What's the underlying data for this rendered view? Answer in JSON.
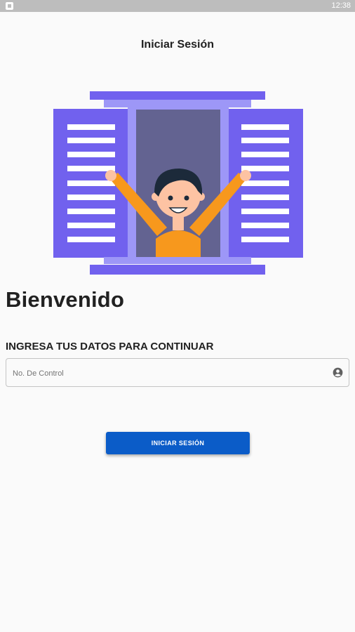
{
  "status_bar": {
    "time": "12:38",
    "app_icon": "app-notification-icon"
  },
  "header": {
    "title": "Iniciar Sesión"
  },
  "illustration": {
    "name": "window-boy-illustration",
    "colors": {
      "shutter": "#7161ee",
      "frame": "#9d97f7",
      "glass": "#636391",
      "slats": "#ffffff",
      "shirt": "#f7981d",
      "skin": "#fdc3a3",
      "hair": "#1c2a3a"
    }
  },
  "main": {
    "welcome": "Bienvenido",
    "subtitle": "INGRESA TUS DATOS PARA CONTINUAR",
    "control_field": {
      "placeholder": "No. De Control",
      "value": "",
      "icon": "account-circle-icon"
    },
    "login_button": {
      "label": "INICIAR SESIÓN",
      "color": "#0b5cc8"
    }
  }
}
